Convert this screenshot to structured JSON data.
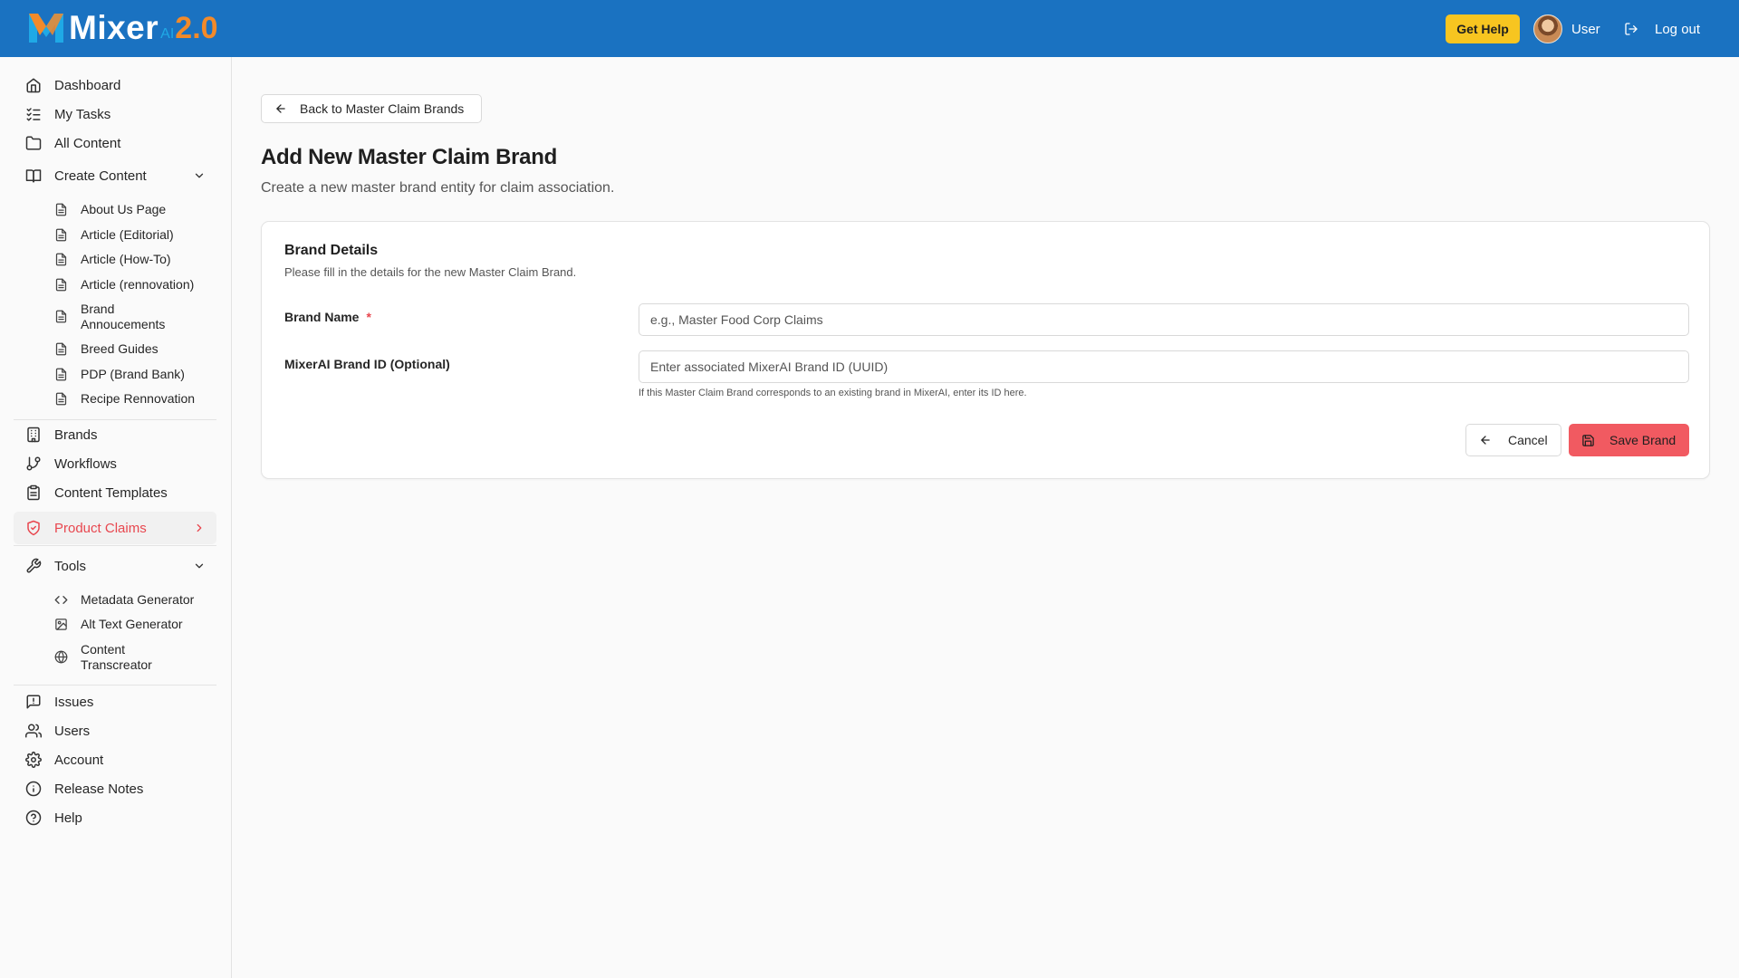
{
  "header": {
    "logo_word": "Mixer",
    "logo_ai": "AI",
    "logo_version": "2.0",
    "get_help_label": "Get Help",
    "user_label": "User",
    "logout_label": "Log out"
  },
  "sidebar": {
    "items": [
      {
        "label": "Dashboard",
        "icon": "home-icon"
      },
      {
        "label": "My Tasks",
        "icon": "checklist-icon"
      },
      {
        "label": "All Content",
        "icon": "folder-icon"
      },
      {
        "label": "Create Content",
        "icon": "book-icon",
        "expanded": true
      }
    ],
    "create_content_items": [
      {
        "label": "About Us Page",
        "icon": "file-icon"
      },
      {
        "label": "Article (Editorial)",
        "icon": "file-icon"
      },
      {
        "label": "Article (How-To)",
        "icon": "file-icon"
      },
      {
        "label": "Article (rennovation)",
        "icon": "file-icon"
      },
      {
        "label": "Brand Annoucements",
        "icon": "file-icon"
      },
      {
        "label": "Breed Guides",
        "icon": "file-icon"
      },
      {
        "label": "PDP (Brand Bank)",
        "icon": "file-icon"
      },
      {
        "label": "Recipe Rennovation",
        "icon": "file-icon"
      }
    ],
    "mid_items": [
      {
        "label": "Brands",
        "icon": "building-icon"
      },
      {
        "label": "Workflows",
        "icon": "git-branch-icon"
      },
      {
        "label": "Content Templates",
        "icon": "clipboard-icon"
      },
      {
        "label": "Product Claims",
        "icon": "shield-check-icon",
        "active": true
      }
    ],
    "tools": {
      "label": "Tools",
      "icon": "wrench-icon",
      "expanded": true
    },
    "tools_items": [
      {
        "label": "Metadata Generator",
        "icon": "code-icon"
      },
      {
        "label": "Alt Text Generator",
        "icon": "image-icon"
      },
      {
        "label": "Content Transcreator",
        "icon": "globe-icon"
      }
    ],
    "bottom_items": [
      {
        "label": "Issues",
        "icon": "message-alert-icon"
      },
      {
        "label": "Users",
        "icon": "users-icon"
      },
      {
        "label": "Account",
        "icon": "gear-icon"
      },
      {
        "label": "Release Notes",
        "icon": "info-icon"
      },
      {
        "label": "Help",
        "icon": "help-circle-icon"
      }
    ],
    "active_color": "#e8474f"
  },
  "main": {
    "back_label": "Back to Master Claim Brands",
    "title": "Add New Master Claim Brand",
    "subtitle": "Create a new master brand entity for claim association.",
    "card": {
      "title": "Brand Details",
      "description": "Please fill in the details for the new Master Claim Brand.",
      "brand_name_label": "Brand Name",
      "brand_name_required": "*",
      "brand_name_value": "",
      "brand_name_placeholder": "e.g., Master Food Corp Claims",
      "brand_id_label": "MixerAI Brand ID (Optional)",
      "brand_id_value": "",
      "brand_id_placeholder": "Enter associated MixerAI Brand ID (UUID)",
      "brand_id_hint": "If this Master Claim Brand corresponds to an existing brand in MixerAI, enter its ID here.",
      "cancel_label": "Cancel",
      "save_label": "Save Brand"
    }
  },
  "colors": {
    "header_bg": "#1a72c1",
    "get_help_bg": "#f7c520",
    "save_bg": "#f15a61",
    "accent_red": "#e8474f"
  }
}
